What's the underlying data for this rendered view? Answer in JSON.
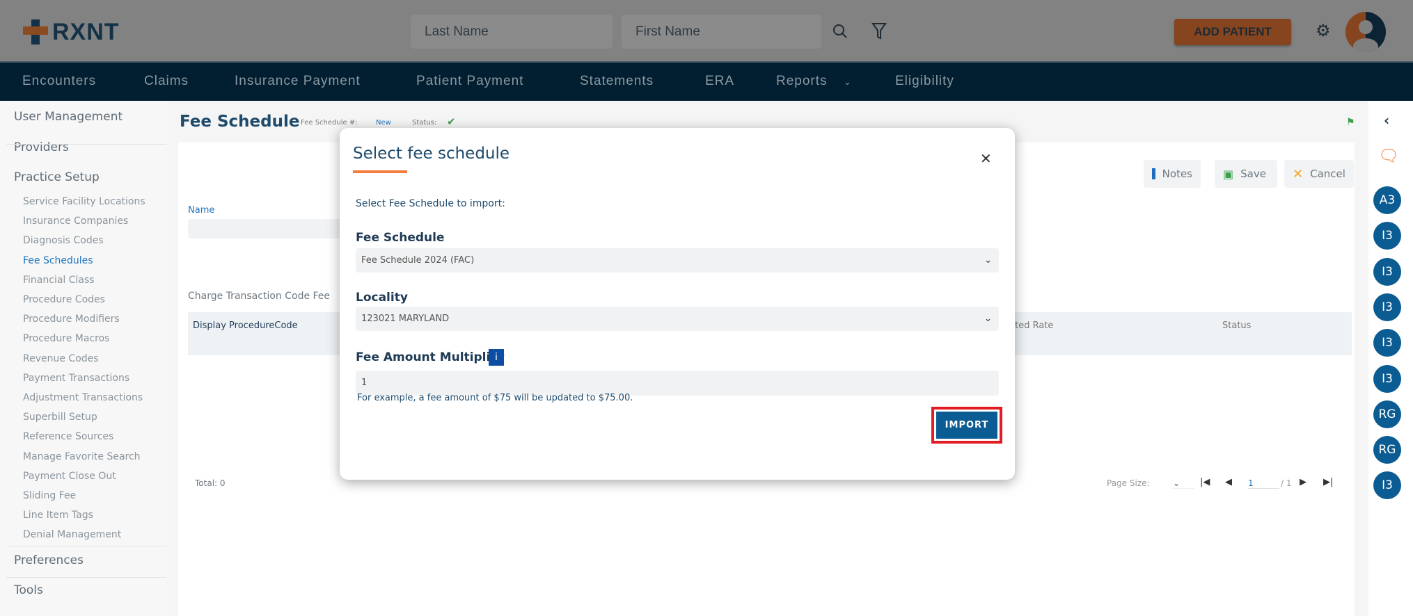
{
  "header": {
    "logo": "RXNT",
    "last_name_placeholder": "Last Name",
    "first_name_placeholder": "First Name",
    "add_patient": "ADD PATIENT"
  },
  "nav": [
    "Encounters",
    "Claims",
    "Insurance Payment",
    "Patient Payment",
    "Statements",
    "ERA",
    "Reports",
    "Eligibility"
  ],
  "sidebar": {
    "top": [
      "User Management",
      "Providers",
      "Practice Setup"
    ],
    "sub": [
      "Service Facility Locations",
      "Insurance Companies",
      "Diagnosis Codes",
      "Fee Schedules",
      "Financial Class",
      "Procedure Codes",
      "Procedure Modifiers",
      "Procedure Macros",
      "Revenue Codes",
      "Payment Transactions",
      "Adjustment Transactions",
      "Superbill Setup",
      "Reference Sources",
      "Manage Favorite Search",
      "Payment Close Out",
      "Sliding Fee",
      "Line Item Tags",
      "Denial Management"
    ],
    "bottom": [
      "Preferences",
      "Tools"
    ],
    "active": "Fee Schedules"
  },
  "page": {
    "title": "Fee Schedule",
    "number_label": "Fee Schedule #:",
    "number_value": "New",
    "status_label": "Status:",
    "notes": "Notes",
    "save": "Save",
    "cancel": "Cancel",
    "name_label": "Name",
    "section": "Charge Transaction Code Fee",
    "columns": [
      "Display ProcedureCode",
      "ected Rate",
      "Status"
    ],
    "total": "Total: 0",
    "page_size_label": "Page Size:",
    "page": "1",
    "page_of": "/ 1"
  },
  "rail": {
    "avatars": [
      "A3",
      "I3",
      "I3",
      "I3",
      "I3",
      "I3",
      "RG",
      "RG",
      "I3"
    ]
  },
  "modal": {
    "title": "Select fee schedule",
    "subtitle": "Select Fee Schedule to import:",
    "fee_schedule_label": "Fee Schedule",
    "fee_schedule_value": "Fee Schedule 2024 (FAC)",
    "locality_label": "Locality",
    "locality_value": "123021 MARYLAND",
    "multiplier_label": "Fee Amount Multiplier",
    "multiplier_value": "1",
    "helper": "For example, a fee amount of $75 will be updated to $75.00.",
    "import": "IMPORT"
  },
  "colors": {
    "accent": "#f47c3c",
    "primary": "#0b5c92",
    "nav": "#011f30",
    "highlight": "#e31b23"
  }
}
